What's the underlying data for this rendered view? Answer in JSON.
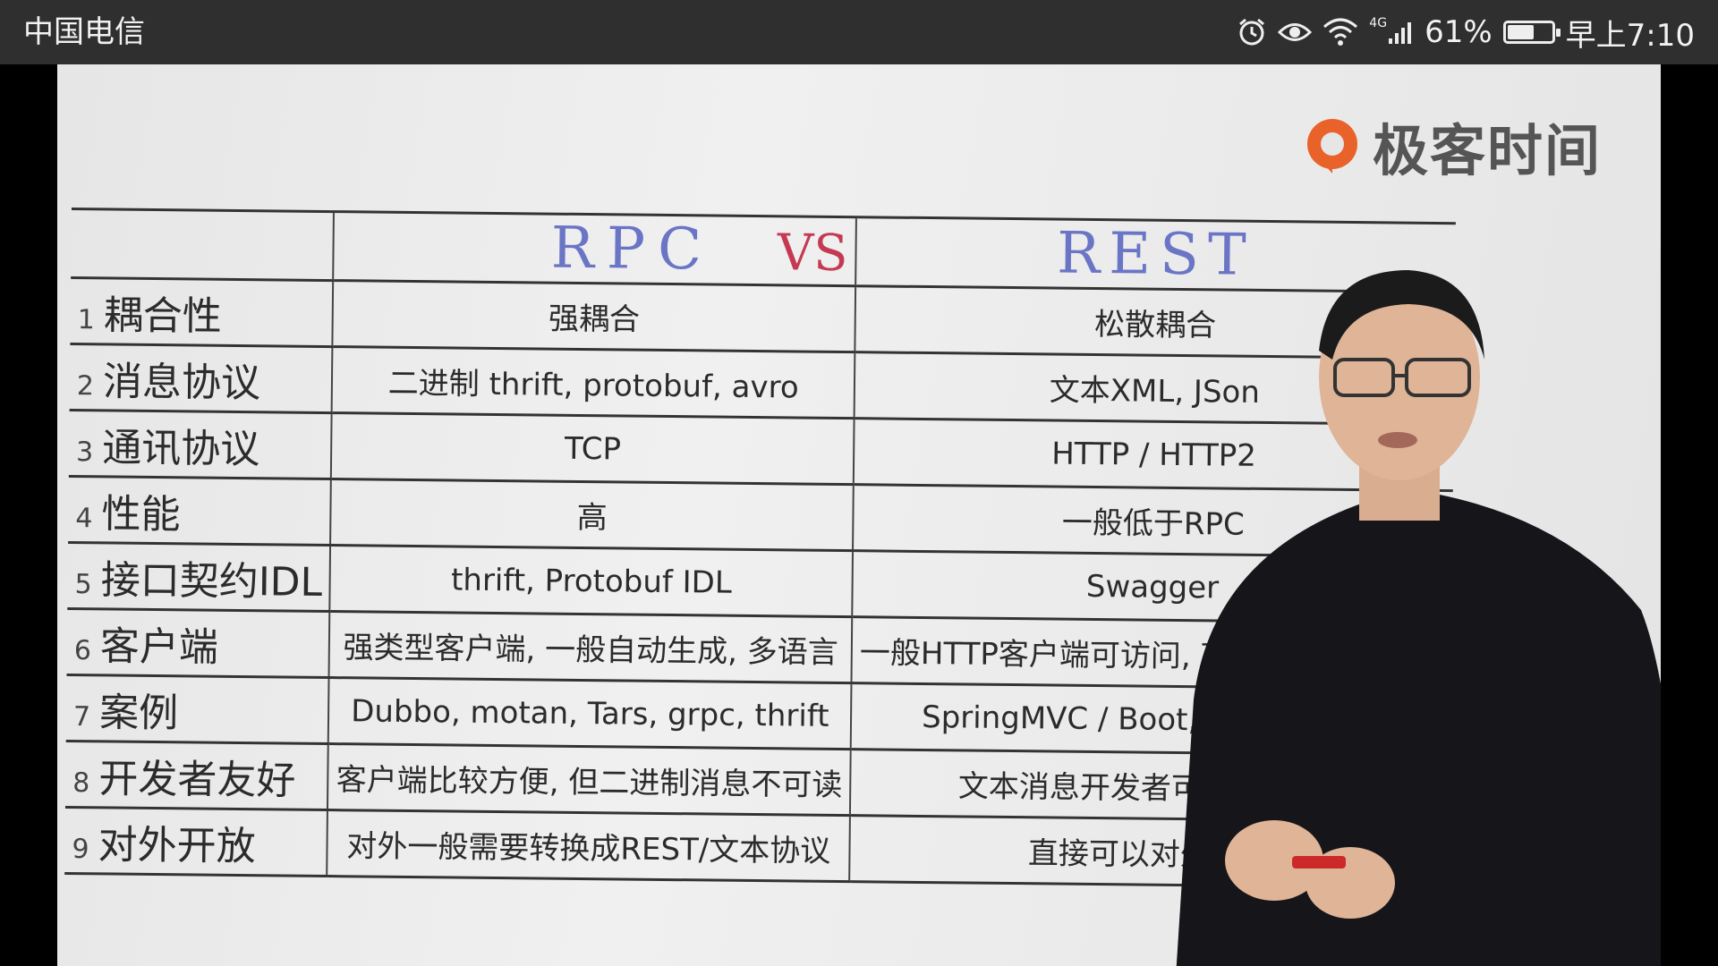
{
  "statusbar": {
    "carrier": "中国电信",
    "network": "4G",
    "battery_text": "61%",
    "battery_level": 0.61,
    "time": "早上7:10",
    "icons": [
      "alarm-icon",
      "eye-icon",
      "wifi-icon",
      "signal-icon",
      "battery-icon"
    ]
  },
  "video": {
    "logo_text": "极客时间",
    "logo_color": "#e8622a",
    "table": {
      "header": {
        "left": "RPC",
        "vs": "VS",
        "right": "REST"
      },
      "rows": [
        {
          "num": "1",
          "label": "耦合性",
          "rpc": "强耦合",
          "rest": "松散耦合"
        },
        {
          "num": "2",
          "label": "消息协议",
          "rpc": "二进制 thrift, protobuf, avro",
          "rest": "文本XML, JSon"
        },
        {
          "num": "3",
          "label": "通讯协议",
          "rpc": "TCP",
          "rest": "HTTP / HTTP2"
        },
        {
          "num": "4",
          "label": "性能",
          "rpc": "高",
          "rest": "一般低于RPC"
        },
        {
          "num": "5",
          "label": "接口契约IDL",
          "rpc": "thrift, Protobuf IDL",
          "rest": "Swagger"
        },
        {
          "num": "6",
          "label": "客户端",
          "rpc": "强类型客户端, 一般自动生成, 多语言",
          "rest": "一般HTTP客户端可访问, 可自动生成强类型"
        },
        {
          "num": "7",
          "label": "案例",
          "rpc": "Dubbo, motan, Tars, grpc, thrift",
          "rest": "SpringMVC / Boot, Jax-rs, drop"
        },
        {
          "num": "8",
          "label": "开发者友好",
          "rpc": "客户端比较方便, 但二进制消息不可读",
          "rest": "文本消息开发者可读, 浏览器"
        },
        {
          "num": "9",
          "label": "对外开放",
          "rpc": "对外一般需要转换成REST/文本协议",
          "rest": "直接可以对外开放"
        }
      ]
    }
  }
}
